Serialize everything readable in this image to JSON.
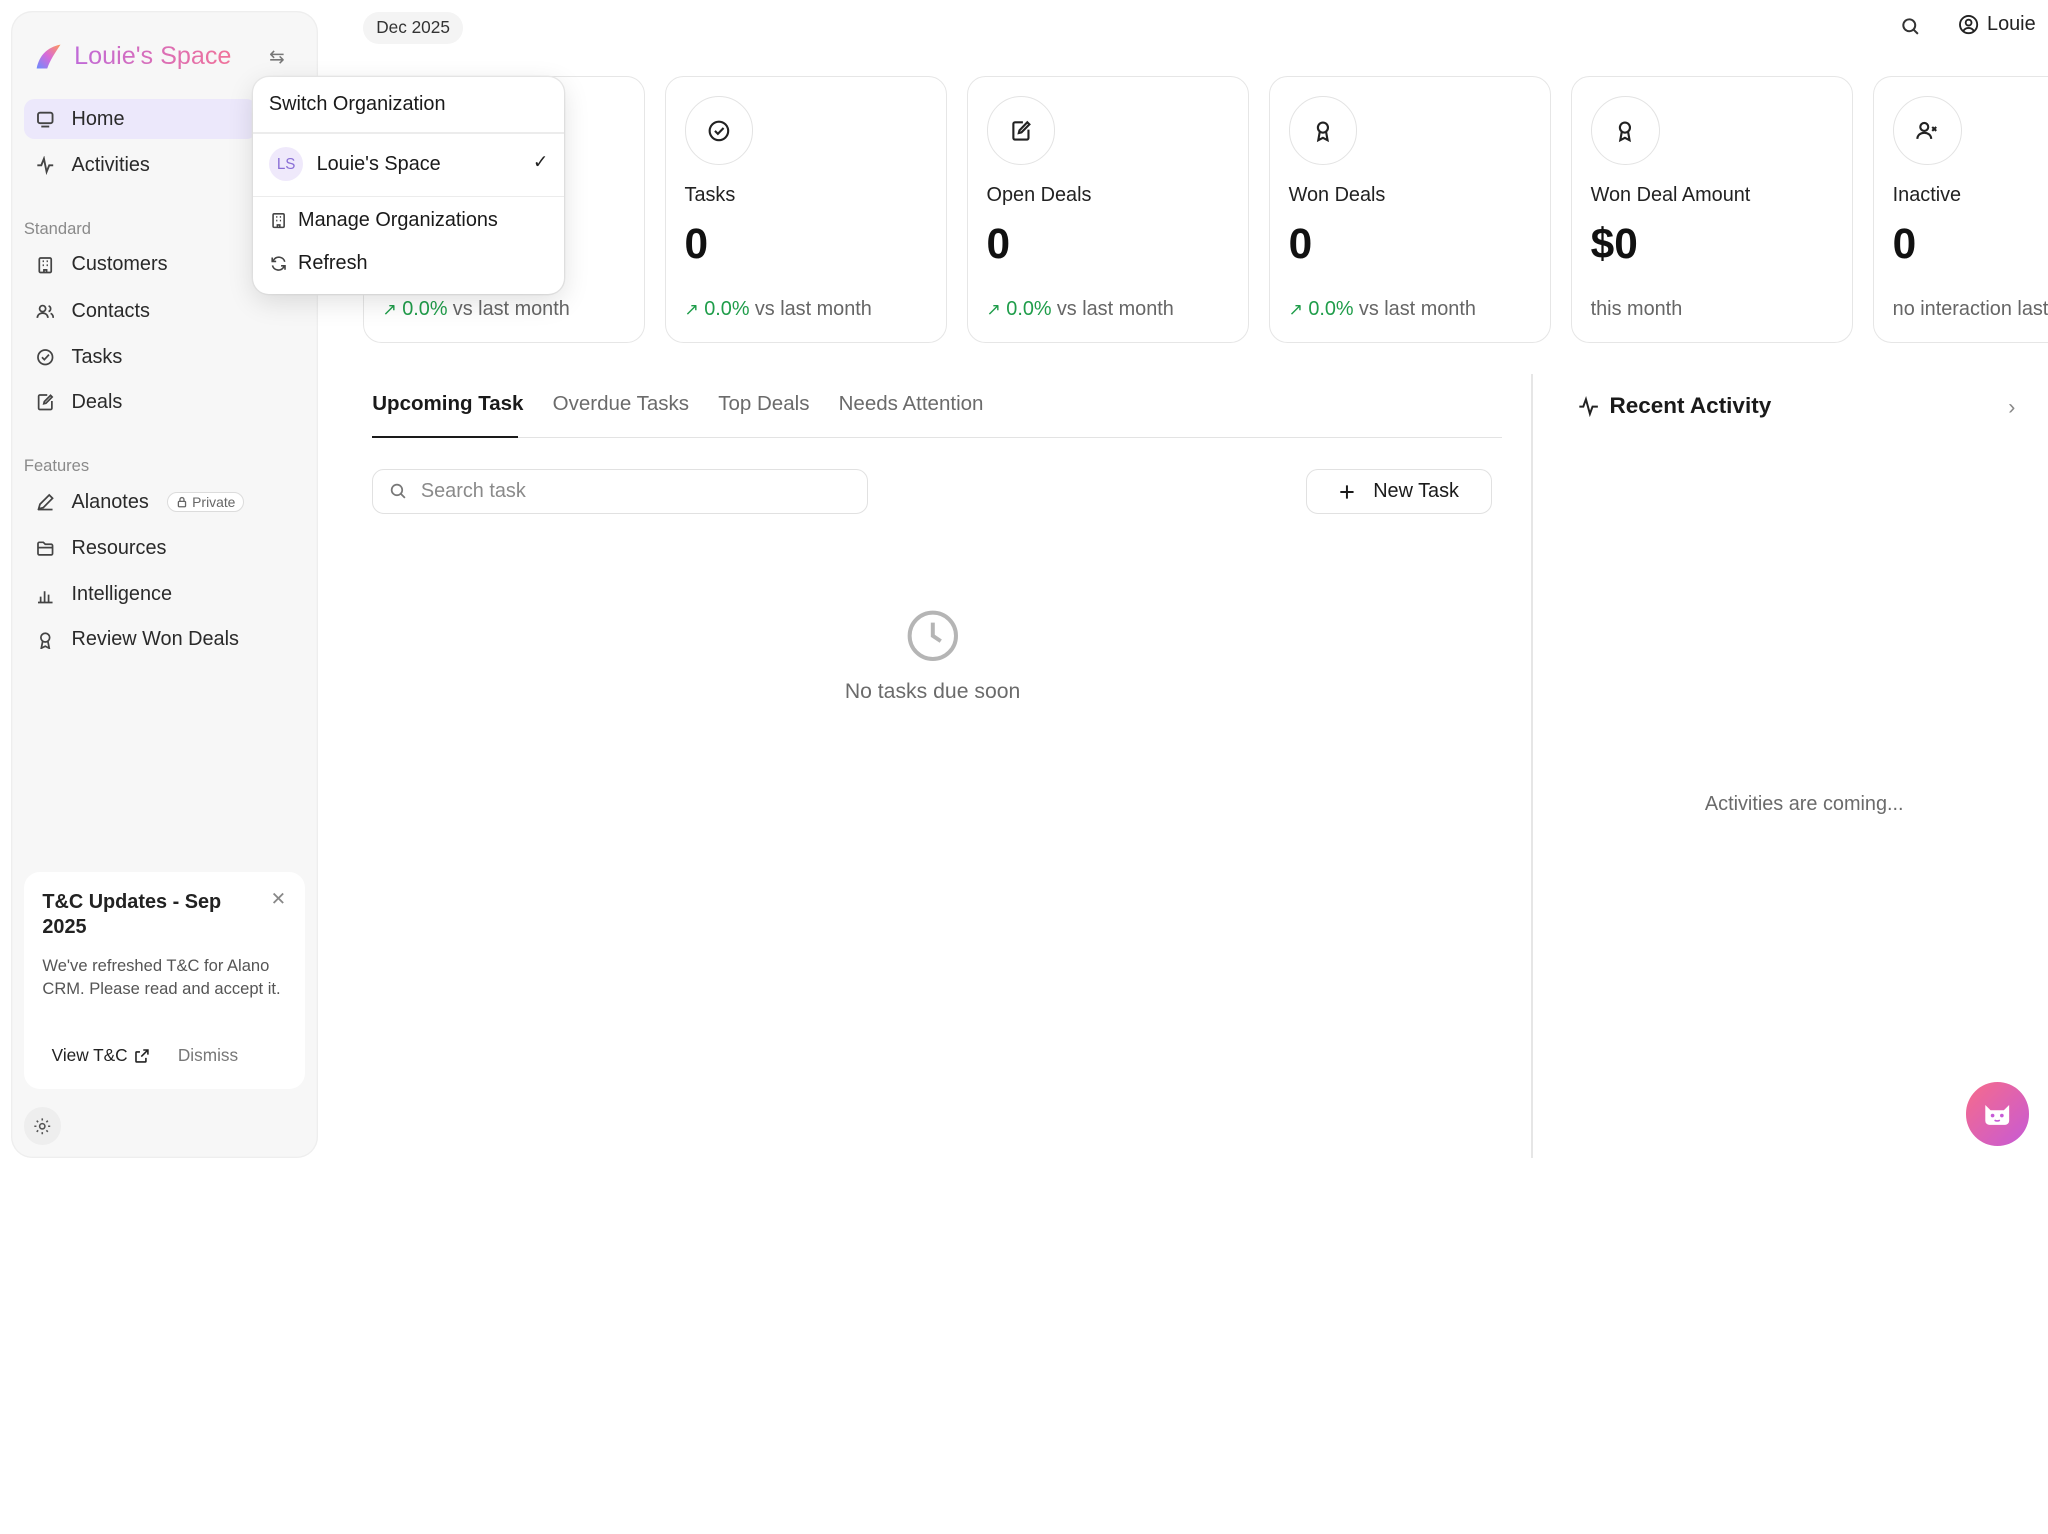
{
  "sidebar": {
    "brand": "Louie's Space",
    "nav_main": [
      {
        "label": "Home",
        "icon": "monitor-icon",
        "active": true
      },
      {
        "label": "Activities",
        "icon": "activity-icon"
      }
    ],
    "standard_label": "Standard",
    "nav_standard": [
      {
        "label": "Customers",
        "icon": "building-icon"
      },
      {
        "label": "Contacts",
        "icon": "users-icon"
      },
      {
        "label": "Tasks",
        "icon": "check-circle-icon"
      },
      {
        "label": "Deals",
        "icon": "edit-document-icon"
      }
    ],
    "features_label": "Features",
    "nav_features": [
      {
        "label": "Alanotes",
        "icon": "pen-icon",
        "badge": "Private"
      },
      {
        "label": "Resources",
        "icon": "folder-icon"
      },
      {
        "label": "Intelligence",
        "icon": "bar-chart-icon"
      },
      {
        "label": "Review Won Deals",
        "icon": "award-icon"
      }
    ],
    "tnc": {
      "title": "T&C Updates - Sep 2025",
      "body": "We've refreshed T&C for Alano CRM. Please read and accept it.",
      "view_label": "View T&C",
      "dismiss_label": "Dismiss"
    }
  },
  "header": {
    "date": "Dec 2025",
    "user": "Louie"
  },
  "cards": [
    {
      "label": "Tasks",
      "value": "0",
      "pct": "0.0%",
      "trend": "vs last month",
      "icon": "check-circle-icon"
    },
    {
      "label": "Open Deals",
      "value": "0",
      "pct": "0.0%",
      "trend": "vs last month",
      "icon": "edit-document-icon"
    },
    {
      "label": "Won Deals",
      "value": "0",
      "pct": "0.0%",
      "trend": "vs last month",
      "icon": "award-icon"
    },
    {
      "label": "Won Deal Amount",
      "value": "$0",
      "trend": "this month",
      "icon": "award-icon"
    },
    {
      "label": "Inactive",
      "value": "0",
      "trend": "no interaction last",
      "icon": "user-x-icon"
    }
  ],
  "first_card_trend": {
    "pct": "0.0%",
    "trend": "vs last month"
  },
  "tabs": [
    "Upcoming Task",
    "Overdue Tasks",
    "Top Deals",
    "Needs Attention"
  ],
  "search": {
    "placeholder": "Search task"
  },
  "new_task_label": "New Task",
  "empty_tasks": "No tasks due soon",
  "recent_activity": {
    "title": "Recent Activity",
    "empty": "Activities are coming..."
  },
  "org_dropdown": {
    "title": "Switch Organization",
    "org_initials": "LS",
    "org_name": "Louie's Space",
    "manage_label": "Manage Organizations",
    "refresh_label": "Refresh"
  },
  "colors": {
    "accent": "#ece8fb",
    "trend_positive": "#1f9d4a",
    "brand_gradient_start": "#c06ad8",
    "brand_gradient_end": "#f0729a"
  }
}
